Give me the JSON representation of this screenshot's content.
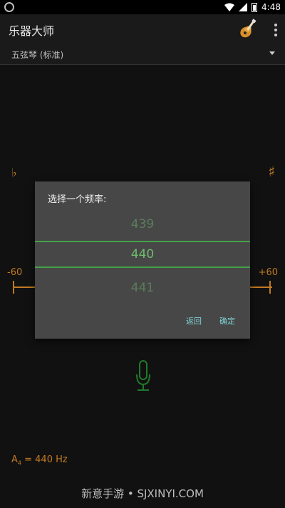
{
  "status_bar": {
    "time": "4:48"
  },
  "app_bar": {
    "title": "乐器大师"
  },
  "instrument": {
    "selected": "五弦琴 (标准)"
  },
  "meter": {
    "flat_symbol": "♭",
    "sharp_symbol": "♯",
    "left_label": "-60",
    "right_label": "+60"
  },
  "dialog": {
    "title": "选择一个频率:",
    "options": [
      "439",
      "440",
      "441"
    ],
    "selected_index": 1,
    "back_label": "返回",
    "ok_label": "确定"
  },
  "reference": {
    "note": "A",
    "octave": "4",
    "value": " = 440 Hz"
  },
  "watermark": "新意手游 • SJXINYI.COM",
  "colors": {
    "accent_orange": "#c07a22",
    "accent_green": "#43a047",
    "dialog_bg": "#474747"
  }
}
